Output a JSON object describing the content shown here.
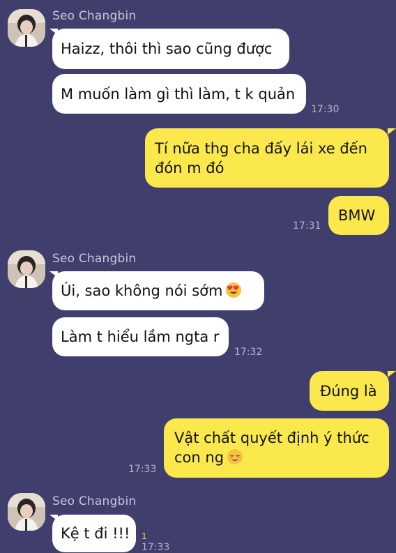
{
  "chat": {
    "sender_name": "Seo Changbin",
    "groups": [
      {
        "sender": "Seo Changbin",
        "messages": [
          "Haizz, thôi thì sao cũng được",
          "M muốn làm gì thì làm, t k quản"
        ],
        "time": "17:30"
      },
      {
        "sender": "me",
        "messages": [
          "Tí nữa thg cha đấy lái xe đến",
          "đón m đó"
        ],
        "time": ""
      },
      {
        "sender": "me",
        "messages": [
          "BMW"
        ],
        "time": "17:31"
      },
      {
        "sender": "Seo Changbin",
        "messages": [
          "Úi, sao không nói sớm",
          "Làm t hiểu lầm ngta r"
        ],
        "emoji": "heart-eyes-emoji",
        "time": "17:32"
      },
      {
        "sender": "me",
        "messages": [
          "Đúng là",
          "Vật chất quyết định ý thức",
          "con ng"
        ],
        "emoji": "relieved-face-emoji",
        "time": "17:33"
      },
      {
        "sender": "Seo Changbin",
        "messages": [
          "Kệ t đi !!!"
        ],
        "unread_count": "1",
        "time": "17:33"
      }
    ]
  },
  "colors": {
    "background": "#403E6D",
    "incoming_bubble": "#FFFFFF",
    "outgoing_bubble": "#FAE84C",
    "unread": "#F2D94A"
  }
}
